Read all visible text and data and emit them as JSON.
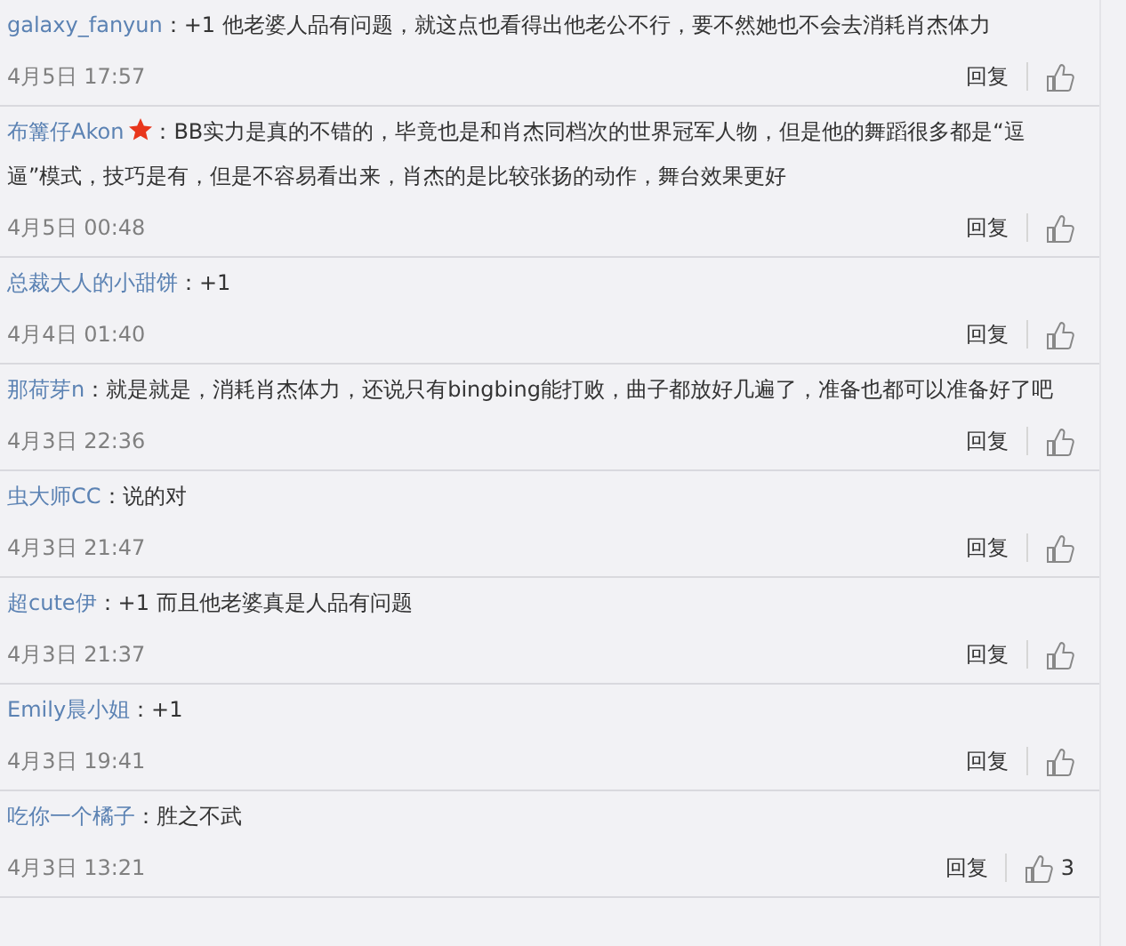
{
  "comments": [
    {
      "user": "galaxy_fanyun",
      "vip": false,
      "text": "：+1 他老婆人品有问题，就这点也看得出他老公不行，要不然她也不会去消耗肖杰体力",
      "time": "4月5日 17:57",
      "reply": "回复"
    },
    {
      "user": "布篝仔Akon",
      "vip": true,
      "text": "：BB实力是真的不错的，毕竟也是和肖杰同档次的世界冠军人物，但是他的舞蹈很多都是“逗逼”模式，技巧是有，但是不容易看出来，肖杰的是比较张扬的动作，舞台效果更好",
      "time": "4月5日 00:48",
      "reply": "回复"
    },
    {
      "user": "总裁大人的小甜饼",
      "vip": false,
      "text": "：+1",
      "time": "4月4日 01:40",
      "reply": "回复"
    },
    {
      "user": "那荷芽n",
      "vip": false,
      "text": "：就是就是，消耗肖杰体力，还说只有bingbing能打败，曲子都放好几遍了，准备也都可以准备好了吧",
      "time": "4月3日 22:36",
      "reply": "回复"
    },
    {
      "user": "虫大师CC",
      "vip": false,
      "text": "：说的对",
      "time": "4月3日 21:47",
      "reply": "回复"
    },
    {
      "user": "超cute伊",
      "vip": false,
      "text": "：+1 而且他老婆真是人品有问题",
      "time": "4月3日 21:37",
      "reply": "回复"
    },
    {
      "user": "Emily晨小姐",
      "vip": false,
      "text": "：+1",
      "time": "4月3日 19:41",
      "reply": "回复"
    },
    {
      "user": "吃你一个橘子",
      "vip": false,
      "text": "：胜之不武",
      "time": "4月3日 13:21",
      "reply": "回复",
      "likes": "3"
    }
  ]
}
